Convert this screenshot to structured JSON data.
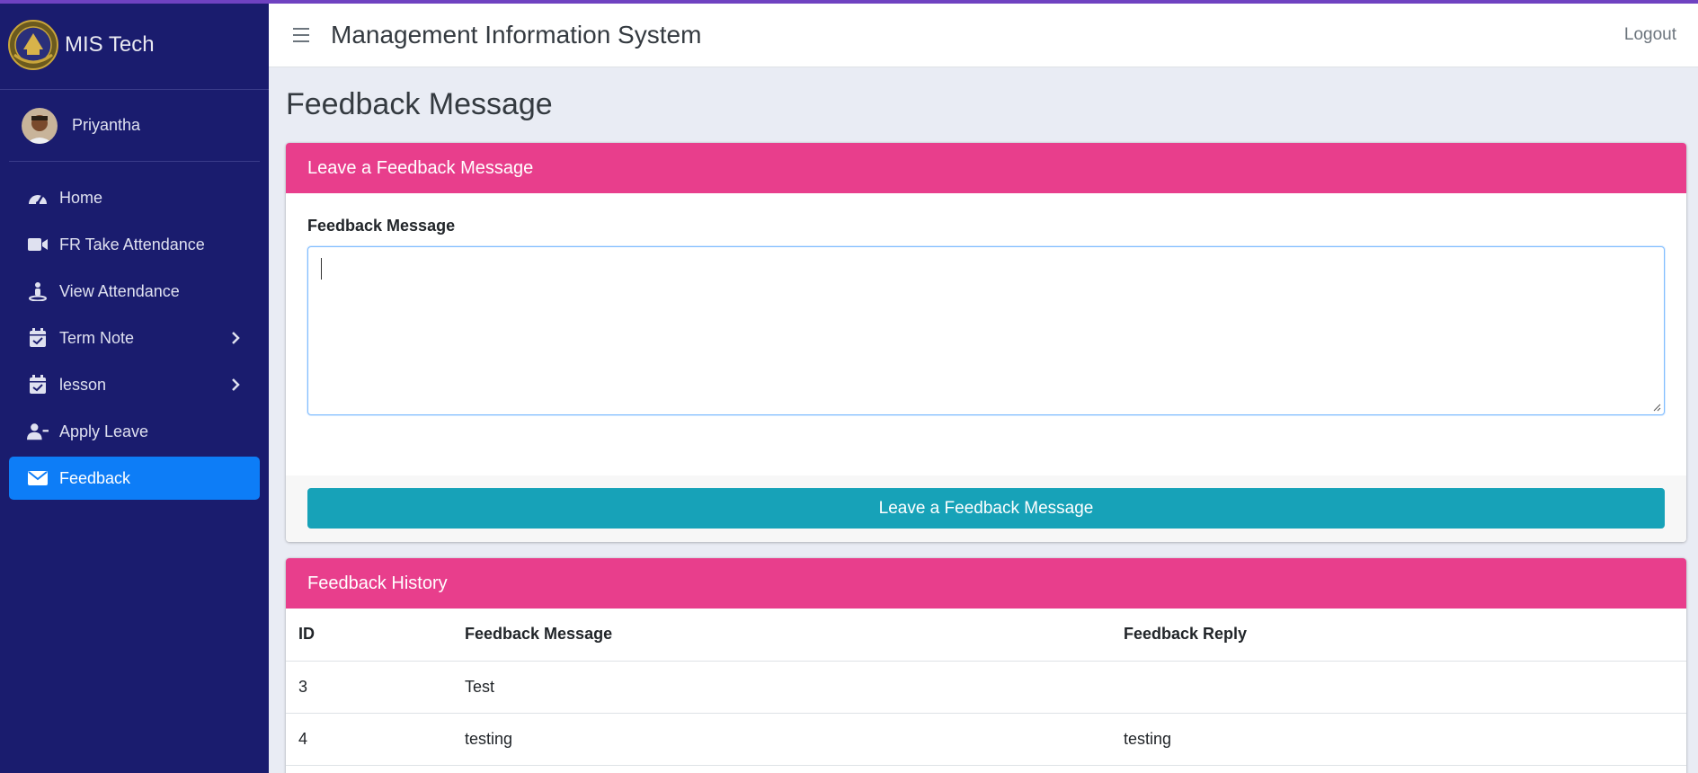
{
  "app": {
    "brand_name": "MIS Tech",
    "header_title": "Management Information System",
    "logout_label": "Logout",
    "accent_color": "#e83e8c",
    "sidebar_color": "#1a1c6e",
    "active_color": "#0d7df7"
  },
  "user": {
    "name": "Priyantha"
  },
  "sidebar": {
    "items": [
      {
        "label": "Home",
        "icon": "dashboard-gauge-icon",
        "has_submenu": false,
        "active": false
      },
      {
        "label": "FR Take Attendance",
        "icon": "video-camera-icon",
        "has_submenu": false,
        "active": false
      },
      {
        "label": "View Attendance",
        "icon": "person-standing-icon",
        "has_submenu": false,
        "active": false
      },
      {
        "label": "Term Note",
        "icon": "calendar-check-icon",
        "has_submenu": true,
        "active": false
      },
      {
        "label": "lesson",
        "icon": "calendar-check-icon",
        "has_submenu": true,
        "active": false
      },
      {
        "label": "Apply Leave",
        "icon": "user-minus-icon",
        "has_submenu": false,
        "active": false
      },
      {
        "label": "Feedback",
        "icon": "envelope-icon",
        "has_submenu": false,
        "active": true
      }
    ]
  },
  "page": {
    "title": "Feedback Message"
  },
  "feedback_form": {
    "card_title": "Leave a Feedback Message",
    "field_label": "Feedback Message",
    "textarea_value": "",
    "submit_label": "Leave a Feedback Message"
  },
  "history": {
    "card_title": "Feedback History",
    "columns": [
      "ID",
      "Feedback Message",
      "Feedback Reply"
    ],
    "rows": [
      [
        "3",
        "Test",
        ""
      ],
      [
        "4",
        "testing",
        "testing"
      ]
    ]
  }
}
